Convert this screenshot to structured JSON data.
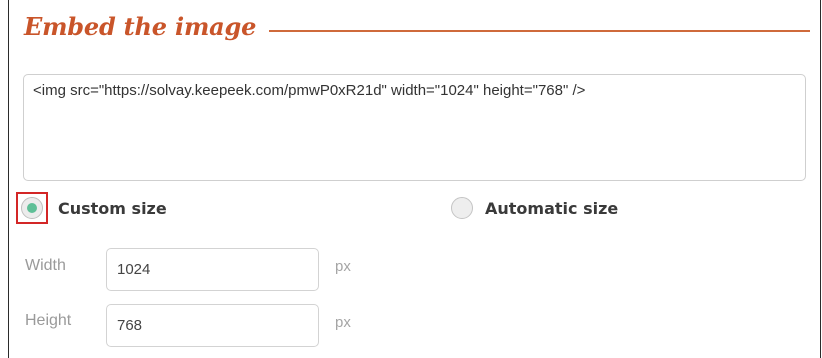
{
  "section": {
    "title": "Embed the image"
  },
  "embed": {
    "code": "<img src=\"https://solvay.keepeek.com/pmwP0xR21d\" width=\"1024\" height=\"768\" />"
  },
  "size_options": {
    "custom": {
      "label": "Custom size",
      "selected": true
    },
    "automatic": {
      "label": "Automatic size",
      "selected": false
    }
  },
  "width_field": {
    "label": "Width",
    "value": "1024",
    "unit": "px"
  },
  "height_field": {
    "label": "Height",
    "value": "768",
    "unit": "px"
  },
  "colors": {
    "accent": "#c9552a",
    "radio_selected": "#5fbf97",
    "highlight_box": "#d32626"
  }
}
